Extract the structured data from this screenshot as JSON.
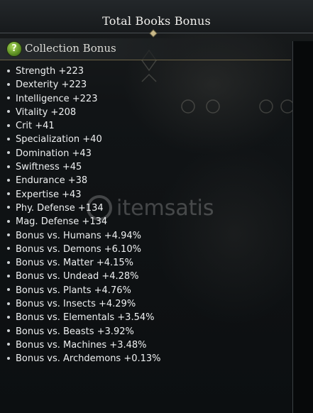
{
  "window": {
    "title": "Total Books Bonus"
  },
  "section": {
    "title": "Collection Bonus",
    "help_icon": "question-mark-icon"
  },
  "stats": [
    {
      "label": "Strength +223"
    },
    {
      "label": "Dexterity +223"
    },
    {
      "label": "Intelligence +223"
    },
    {
      "label": "Vitality +208"
    },
    {
      "label": "Crit +41"
    },
    {
      "label": "Specialization +40"
    },
    {
      "label": "Domination +43"
    },
    {
      "label": "Swiftness +45"
    },
    {
      "label": "Endurance +38"
    },
    {
      "label": "Expertise +43"
    },
    {
      "label": "Phy. Defense +134"
    },
    {
      "label": "Mag. Defense +134"
    },
    {
      "label": "Bonus vs. Humans +4.94%"
    },
    {
      "label": "Bonus vs. Demons +6.10%"
    },
    {
      "label": "Bonus vs. Matter +4.15%"
    },
    {
      "label": "Bonus vs. Undead +4.28%"
    },
    {
      "label": "Bonus vs. Plants +4.76%"
    },
    {
      "label": "Bonus vs. Insects +4.29%"
    },
    {
      "label": "Bonus vs. Elementals +3.54%"
    },
    {
      "label": "Bonus vs. Beasts +3.92%"
    },
    {
      "label": "Bonus vs. Machines +3.48%"
    },
    {
      "label": "Bonus vs. Archdemons +0.13%"
    }
  ],
  "watermark": {
    "text": "itemsatis"
  },
  "colors": {
    "accent_gold": "#6b6245",
    "help_green": "#7fb03a",
    "text": "#eef0f1"
  }
}
